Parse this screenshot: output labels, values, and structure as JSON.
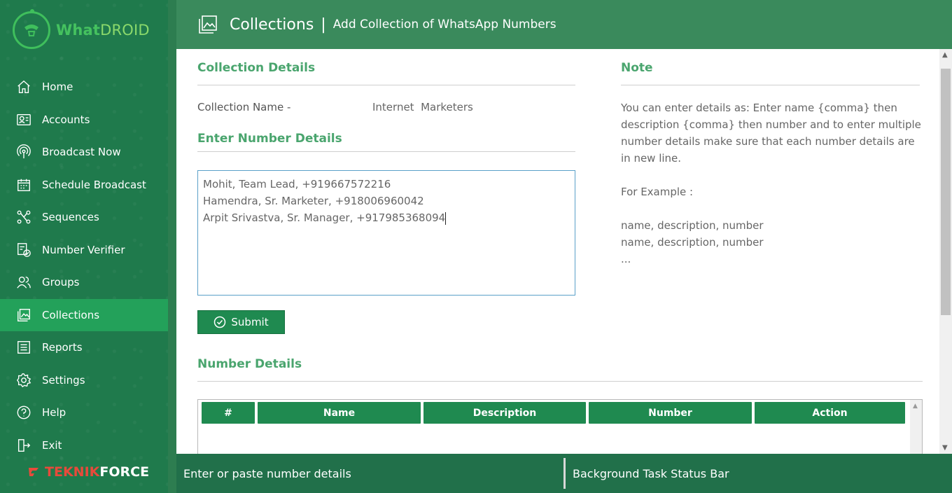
{
  "app": {
    "logo_what": "What",
    "logo_droid": "DROID",
    "brand_red": "TEKNIK",
    "brand_white": "FORCE"
  },
  "sidebar": {
    "items": [
      {
        "label": "Home",
        "icon": "home-icon"
      },
      {
        "label": "Accounts",
        "icon": "accounts-icon"
      },
      {
        "label": "Broadcast Now",
        "icon": "broadcast-icon"
      },
      {
        "label": "Schedule Broadcast",
        "icon": "calendar-icon"
      },
      {
        "label": "Sequences",
        "icon": "sequences-icon"
      },
      {
        "label": "Number Verifier",
        "icon": "verifier-icon"
      },
      {
        "label": "Groups",
        "icon": "groups-icon"
      },
      {
        "label": "Collections",
        "icon": "collections-icon",
        "active": true
      },
      {
        "label": "Reports",
        "icon": "reports-icon"
      },
      {
        "label": "Settings",
        "icon": "settings-icon"
      },
      {
        "label": "Help",
        "icon": "help-icon"
      },
      {
        "label": "Exit",
        "icon": "exit-icon"
      }
    ]
  },
  "header": {
    "title": "Collections",
    "separator": "|",
    "subtitle": "Add Collection of WhatsApp Numbers"
  },
  "form": {
    "collection_details_title": "Collection Details",
    "collection_name_label": "Collection Name -",
    "collection_name_value": "Internet  Marketers",
    "number_details_input_title": "Enter Number Details",
    "lines": [
      "Mohit, Team Lead, +919667572216",
      "Hamendra, Sr. Marketer, +918006960042",
      "Arpit Srivastva, Sr. Manager, +917985368094"
    ],
    "submit_label": "Submit"
  },
  "note": {
    "title": "Note",
    "text": "You can enter details as: Enter name {comma} then description {comma} then number and to enter multiple number details make sure that each number details are in new line.",
    "example_label": "For Example :",
    "example_lines": "name, description, number\nname, description, number\n..."
  },
  "table": {
    "title": "Number Details",
    "columns": [
      "#",
      "Name",
      "Description",
      "Number",
      "Action"
    ]
  },
  "status": {
    "left": "Enter or paste number details",
    "right": "Background Task Status Bar"
  },
  "colors": {
    "sidebar": "#1f7a4c",
    "active": "#23a15a",
    "header": "#3a8a5c",
    "accent_text": "#4aa56e",
    "button": "#1f8a50",
    "status": "#21704a"
  }
}
